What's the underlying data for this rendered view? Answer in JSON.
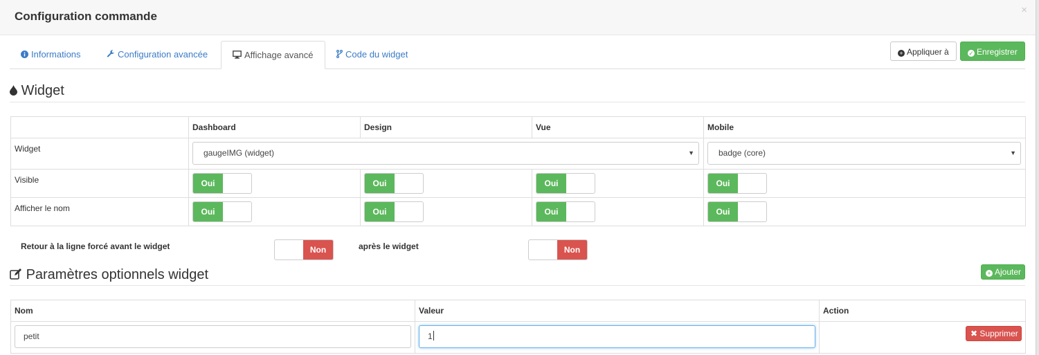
{
  "modal": {
    "title": "Configuration commande",
    "close": "×"
  },
  "tabs": [
    {
      "label": "Informations",
      "icon": "info-circle-icon"
    },
    {
      "label": "Configuration avancée",
      "icon": "wrench-icon"
    },
    {
      "label": "Affichage avancé",
      "icon": "desktop-icon"
    },
    {
      "label": "Code du widget",
      "icon": "code-fork-icon"
    }
  ],
  "actions": {
    "apply_label": "Appliquer à",
    "save_label": "Enregistrer"
  },
  "widget_section": {
    "title": "Widget",
    "columns": [
      "",
      "Dashboard",
      "Design",
      "Vue",
      "Mobile"
    ],
    "rows": {
      "widget_label": "Widget",
      "visible_label": "Visible",
      "show_name_label": "Afficher le nom"
    },
    "selects": {
      "desktop": "gaugeIMG (widget)",
      "mobile": "badge (core)"
    },
    "toggle_on": "Oui"
  },
  "line_break": {
    "before_label": "Retour à la ligne forcé avant le widget",
    "after_label": "après le widget",
    "toggle_off": "Non"
  },
  "params_section": {
    "title": "Paramètres optionnels widget",
    "add_label": "Ajouter",
    "columns": [
      "Nom",
      "Valeur",
      "Action"
    ],
    "rows": [
      {
        "name": "petit",
        "value": "1",
        "delete_label": "Supprimer"
      }
    ]
  },
  "colors": {
    "success": "#5cb85c",
    "danger": "#d9534f",
    "link": "#3a7cc6"
  }
}
